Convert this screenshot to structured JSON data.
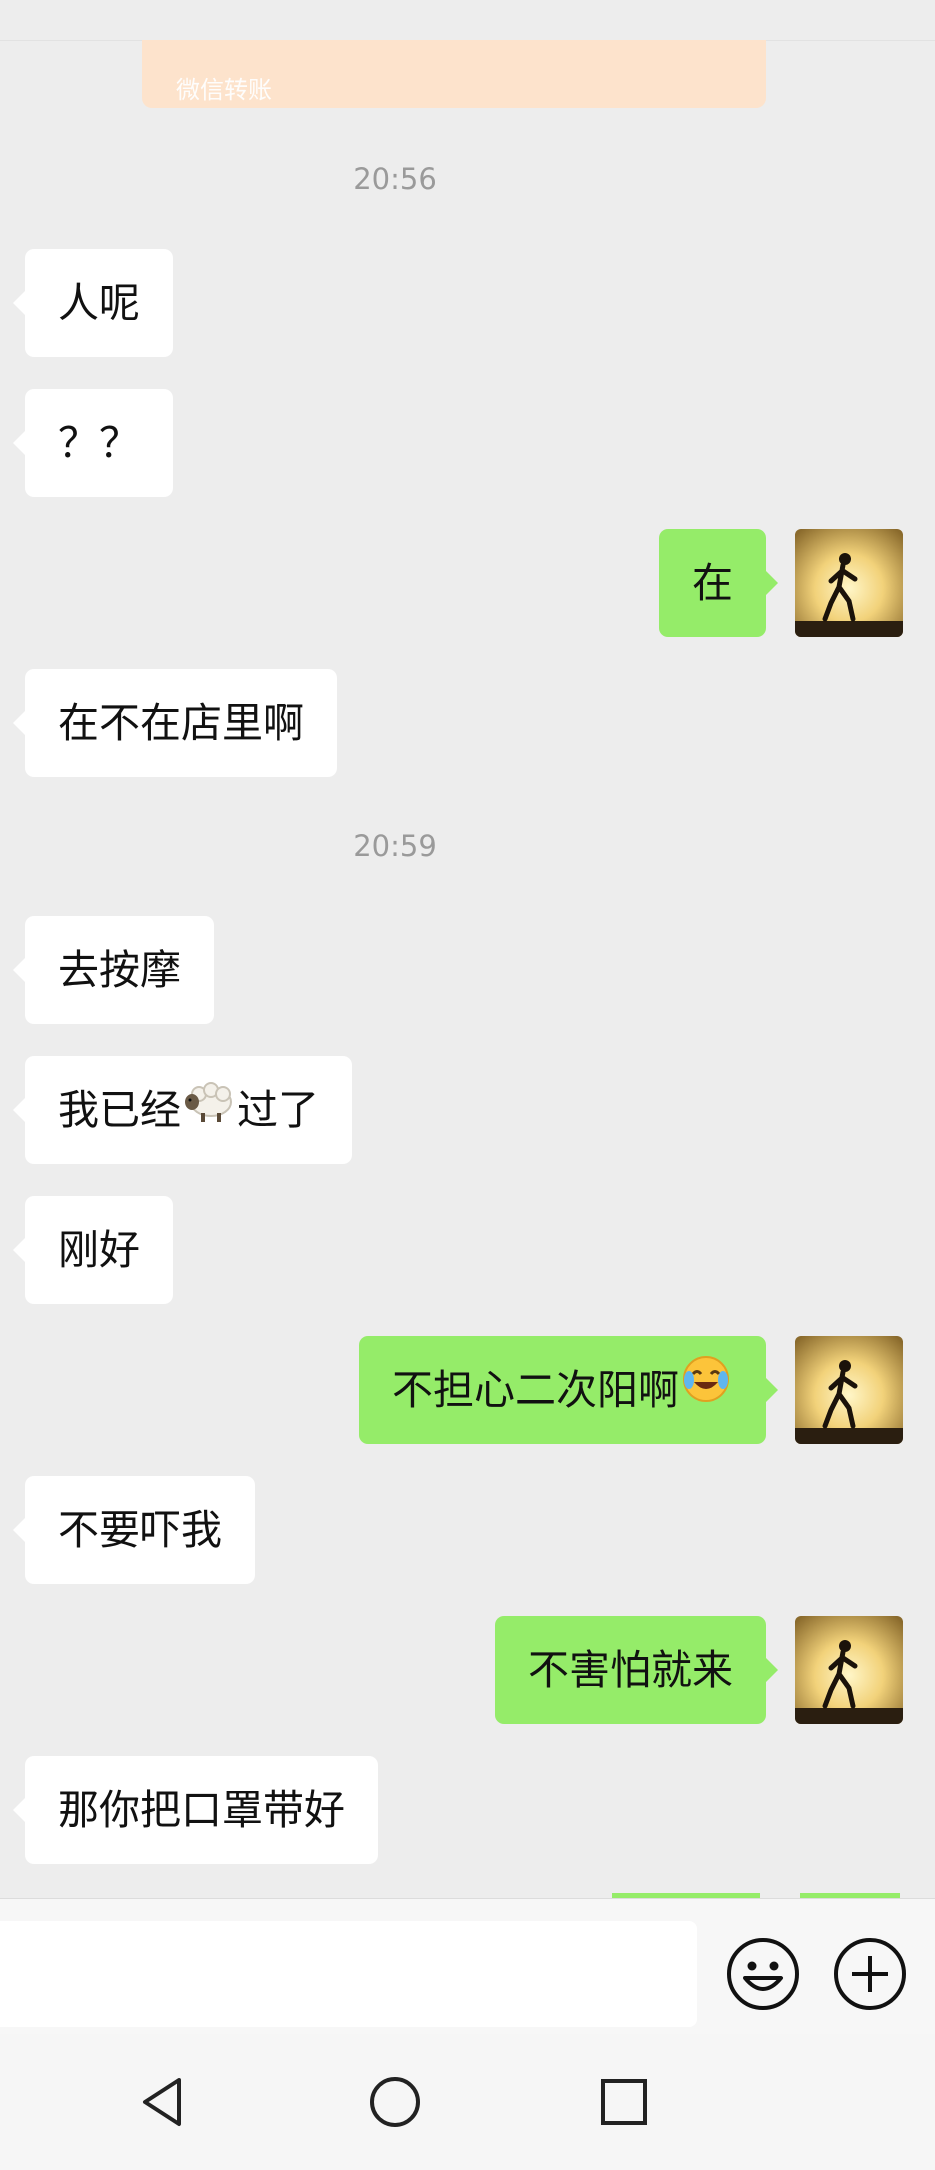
{
  "transfer_card": {
    "label": "微信转账"
  },
  "timestamps": [
    "20:56",
    "20:59"
  ],
  "messages": [
    {
      "side": "left",
      "text": "人呢"
    },
    {
      "side": "left",
      "text": "？？"
    },
    {
      "side": "right",
      "text": "在"
    },
    {
      "side": "left",
      "text": "在不在店里啊"
    },
    {
      "side": "left",
      "text": "去按摩"
    },
    {
      "side": "left",
      "text_before": "我已经",
      "emoji": "sheep-emoji",
      "text_after": "过了"
    },
    {
      "side": "left",
      "text": "刚好"
    },
    {
      "side": "right",
      "text": "不担心二次阳啊",
      "emoji": "crying-laughing-emoji"
    },
    {
      "side": "left",
      "text": "不要吓我"
    },
    {
      "side": "right",
      "text": "不害怕就来"
    },
    {
      "side": "left",
      "text": "那你把口罩带好"
    }
  ],
  "input_bar": {
    "input_value": "",
    "icons": [
      "smiley-icon",
      "plus-icon"
    ]
  },
  "nav_bar": {
    "icons": [
      "back-triangle-icon",
      "home-circle-icon",
      "recents-square-icon"
    ]
  },
  "colors": {
    "background": "#ededed",
    "self_bubble": "#95ec69",
    "other_bubble": "#ffffff",
    "transfer_card": "#fde3cc",
    "timestamp_text": "#9a9a9a"
  }
}
